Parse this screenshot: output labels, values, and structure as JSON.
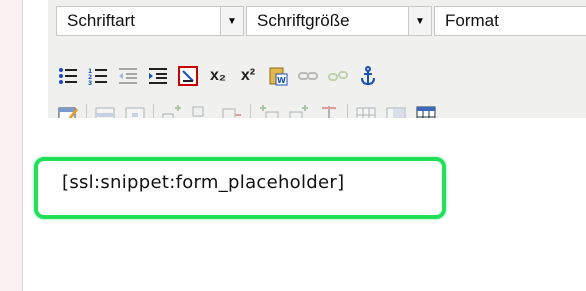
{
  "toolbar": {
    "font_select": {
      "label": "Schriftart"
    },
    "size_select": {
      "label": "Schriftgröße"
    },
    "format_select": {
      "label": "Format"
    },
    "icons_row1": [
      "bullet-list-icon",
      "numbered-list-icon",
      "outdent-icon",
      "indent-icon",
      "remove-formatting-icon",
      "subscript-icon",
      "superscript-icon",
      "paste-from-word-icon",
      "link-icon",
      "unlink-icon",
      "anchor-icon"
    ],
    "subscript_label": "x₂",
    "superscript_label": "x²",
    "icons_row2": [
      "edit-table-icon",
      "table-row-icon",
      "table-cell-icon",
      "insert-row-before-icon",
      "insert-row-after-icon",
      "delete-row-icon",
      "insert-col-before-icon",
      "insert-col-after-icon",
      "delete-col-icon",
      "split-cells-icon",
      "merge-cells-icon",
      "table-icon"
    ]
  },
  "editor": {
    "content": "[ssl:snippet:form_placeholder]"
  },
  "colors": {
    "highlight": "#22e05a",
    "toolbar_bg": "#f0f0ee",
    "left_strip": "#fbf1f1"
  }
}
